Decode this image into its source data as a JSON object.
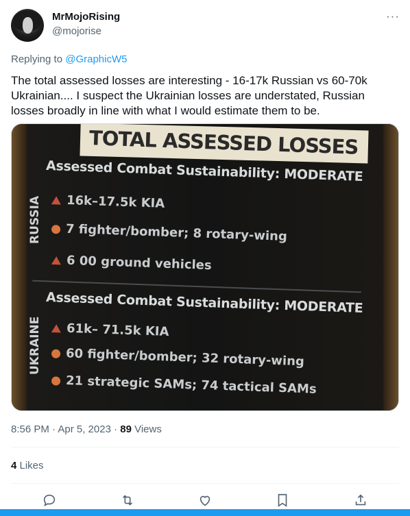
{
  "user": {
    "name": "MrMojoRising",
    "handle": "@mojorise"
  },
  "more_label": "···",
  "reply": {
    "prefix": "Replying to ",
    "mention": "@GraphicW5"
  },
  "tweet_text": "The total assessed losses are interesting - 16-17k Russian vs 60-70k Ukrainian.... I suspect the Ukrainian losses are understated, Russian losses broadly in line with what I would estimate them to be.",
  "image": {
    "title": "TOTAL ASSESSED LOSSES",
    "russia": {
      "label": "RUSSIA",
      "sustainability": "Assessed Combat Sustainability: MODERATE",
      "items": [
        "16k–17.5k KIA",
        "7 fighter/bomber; 8 rotary-wing",
        "6 00 ground vehicles"
      ]
    },
    "ukraine": {
      "label": "UKRAINE",
      "sustainability": "Assessed Combat Sustainability: MODERATE",
      "items": [
        "61k– 71.5k KIA",
        "60 fighter/bomber; 32 rotary-wing",
        "21 strategic SAMs; 74 tactical SAMs"
      ]
    }
  },
  "meta": {
    "time": "8:56 PM · Apr 5, 2023 · ",
    "views_count": "89",
    "views_label": " Views"
  },
  "likes": {
    "count": "4",
    "label": " Likes"
  },
  "actions": [
    "reply-icon",
    "retweet-icon",
    "like-icon",
    "bookmark-icon",
    "share-icon"
  ],
  "colors": {
    "accent": "#1d9bf0",
    "muted": "#536471",
    "text": "#0f1419"
  }
}
